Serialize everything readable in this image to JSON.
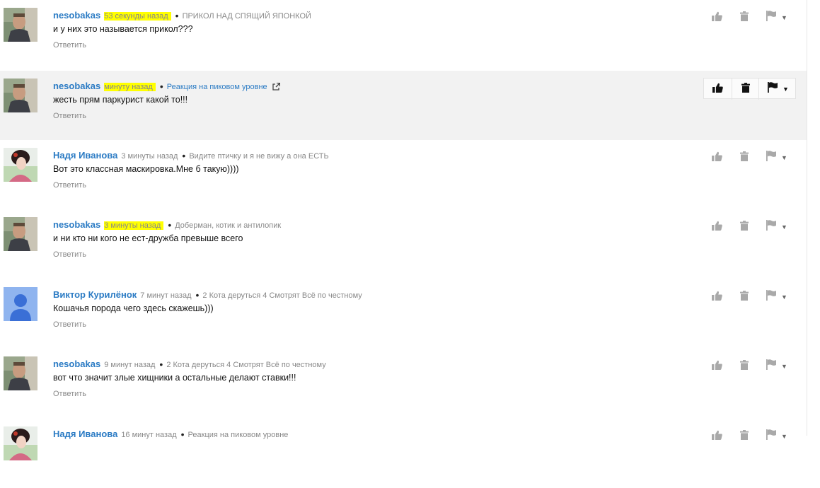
{
  "colors": {
    "author": "#2b7bc4",
    "meta": "#888888",
    "highlight": "#ffff00",
    "hover_bg": "#f2f2f2",
    "icon_idle": "#a9a9a9",
    "icon_active": "#111111"
  },
  "comments": [
    {
      "author": "nesobakas",
      "time": "53 секунды назад",
      "time_highlighted": true,
      "source": "ПРИКОЛ НАД СПЯЩИЙ ЯПОНКОЙ",
      "text": "и у них это называется прикол???",
      "reply_label": "Ответить",
      "avatar": "man-photo"
    },
    {
      "author": "nesobakas",
      "time": "минуту назад",
      "time_highlighted": true,
      "source": "Реакция на пиковом уровне",
      "source_is_link": true,
      "text": "жесть прям паркурист какой то!!!",
      "reply_label": "Ответить",
      "avatar": "man-photo",
      "hovered": true
    },
    {
      "author": "Надя Иванова",
      "time": "3 минуты назад",
      "source": "Видите птичку и я не вижу а она ЕСТЬ",
      "text": "Вот это классная маскировка.Мне б такую))))",
      "reply_label": "Ответить",
      "avatar": "woman-drawing"
    },
    {
      "author": "nesobakas",
      "time": "3 минуты назад",
      "time_highlighted": true,
      "source": "Доберман, котик и антилопик",
      "text": "и ни кто ни кого не ест-дружба превыше всего",
      "reply_label": "Ответить",
      "avatar": "man-photo"
    },
    {
      "author": "Виктор Курилёнок",
      "time": "7 минут назад",
      "source": "2 Кота деруться 4 Смотрят Всё по честному",
      "text": "Кошачья порода чего здесь скажешь)))",
      "reply_label": "Ответить",
      "avatar": "default-user"
    },
    {
      "author": "nesobakas",
      "time": "9 минут назад",
      "source": "2 Кота деруться 4 Смотрят Всё по честному",
      "text": "вот что значит злые хищники а остальные делают ставки!!!",
      "reply_label": "Ответить",
      "avatar": "man-photo"
    },
    {
      "author": "Надя Иванова",
      "time": "16 минут назад",
      "source": "Реакция на пиковом уровне",
      "text": "",
      "reply_label": "",
      "avatar": "woman-drawing"
    }
  ]
}
